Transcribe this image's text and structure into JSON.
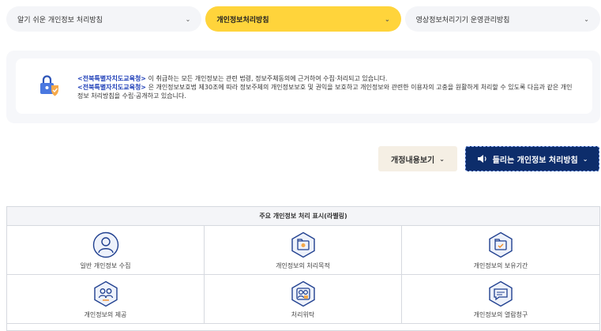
{
  "tabs": [
    {
      "label": "알기 쉬운 개인정보 처리방침"
    },
    {
      "label": "개인정보처리방침"
    },
    {
      "label": "영상정보처리기기 운영관리방침"
    }
  ],
  "intro": {
    "org_name": "<전북특별자치도교육청>",
    "line1_rest": "이 취급하는 모든 개인정보는 관련 법령, 정보주체동의에 근거하여 수집·처리되고 있습니다.",
    "line2_rest": "은 개인정보보호법 제30조에 따라 정보주체의 개인정보보호 및 권익을 보호하고 개인정보와 관련한 이용자의 고충을 원활하게 처리할 수 있도록 다음과 같은 개인정보 처리방침을 수립·공개하고 있습니다."
  },
  "buttons": {
    "history_label": "개정내용보기",
    "audio_label": "들리는 개인정보 처리방침"
  },
  "labeling": {
    "title": "주요 개인정보 처리 표시(라벨링)",
    "items": [
      {
        "label": "일반 개인정보 수집",
        "icon": "user-profile-icon"
      },
      {
        "label": "개인정보의 처리목적",
        "icon": "purpose-folder-icon"
      },
      {
        "label": "개인정보의 보유기간",
        "icon": "retention-folder-icon"
      },
      {
        "label": "개인정보의 제공",
        "icon": "provision-users-icon"
      },
      {
        "label": "처리위탁",
        "icon": "outsourcing-users-icon"
      },
      {
        "label": "개인정보의 열람청구",
        "icon": "access-request-icon"
      }
    ]
  },
  "colors": {
    "active_tab": "#ffd43b",
    "accent_blue": "#1f3fb8",
    "audio_button_bg": "#0d2d6b",
    "history_button_bg": "#f5efe4"
  }
}
